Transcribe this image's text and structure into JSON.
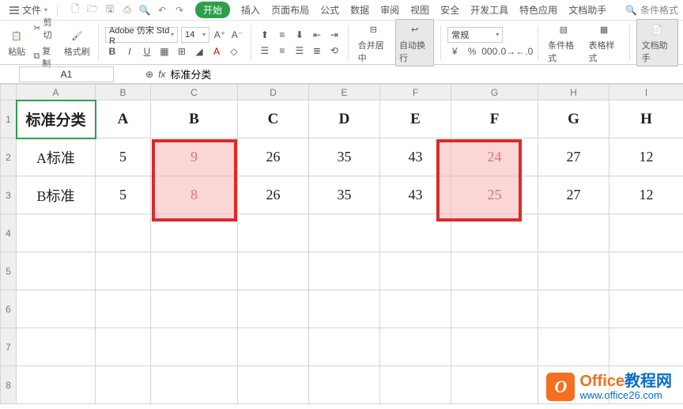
{
  "menubar": {
    "file_label": "文件",
    "tabs": [
      "开始",
      "插入",
      "页面布局",
      "公式",
      "数据",
      "审阅",
      "视图",
      "安全",
      "开发工具",
      "特色应用",
      "文档助手"
    ],
    "active_tab_index": 0,
    "right_label": "条件格式"
  },
  "ribbon": {
    "paste_label": "粘贴",
    "cut_label": "剪切",
    "copy_label": "复制",
    "format_painter_label": "格式刷",
    "font_name": "Adobe 仿宋 Std R",
    "font_size": "14",
    "merge_label": "合并居中",
    "autowrap_label": "自动换行",
    "number_format": "常规",
    "cond_format_label": "条件格式",
    "table_style_label": "表格样式",
    "doc_assistant_label": "文档助手"
  },
  "formula_bar": {
    "cell_ref": "A1",
    "formula": "标准分类"
  },
  "grid": {
    "col_headers": [
      "A",
      "B",
      "C",
      "D",
      "E",
      "F",
      "G",
      "H",
      "I"
    ],
    "row_count": 8,
    "active_cell": "A1",
    "rows": [
      {
        "cells": [
          "标准分类",
          "A",
          "B",
          "C",
          "D",
          "E",
          "F",
          "G",
          "H"
        ]
      },
      {
        "cells": [
          "A标准",
          "5",
          "9",
          "26",
          "35",
          "43",
          "24",
          "27",
          "12"
        ]
      },
      {
        "cells": [
          "B标准",
          "5",
          "8",
          "26",
          "35",
          "43",
          "25",
          "27",
          "12"
        ]
      },
      {
        "cells": [
          "",
          "",
          "",
          "",
          "",
          "",
          "",
          "",
          ""
        ]
      },
      {
        "cells": [
          "",
          "",
          "",
          "",
          "",
          "",
          "",
          "",
          ""
        ]
      },
      {
        "cells": [
          "",
          "",
          "",
          "",
          "",
          "",
          "",
          "",
          ""
        ]
      },
      {
        "cells": [
          "",
          "",
          "",
          "",
          "",
          "",
          "",
          "",
          ""
        ]
      },
      {
        "cells": [
          "",
          "",
          "",
          "",
          "",
          "",
          "",
          "",
          ""
        ]
      }
    ],
    "highlights": [
      {
        "col": 2,
        "row_start": 1,
        "row_end": 2,
        "values": [
          "9",
          "8"
        ]
      },
      {
        "col": 6,
        "row_start": 1,
        "row_end": 2,
        "values": [
          "24",
          "25"
        ]
      }
    ]
  },
  "watermark": {
    "title_a": "Office",
    "title_b": "教程网",
    "url": "www.office26.com"
  }
}
